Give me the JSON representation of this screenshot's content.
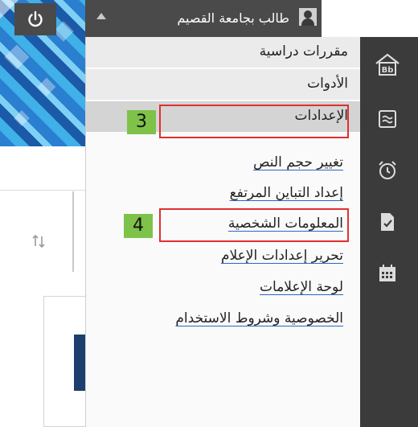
{
  "topbar": {
    "user_name": "طالب بجامعة القصيم",
    "power_icon": "power-icon",
    "caret_icon": "caret-up-icon"
  },
  "menu": {
    "items": [
      {
        "label": "مقررات دراسية"
      },
      {
        "label": "الأدوات"
      },
      {
        "label": "الإعدادات"
      }
    ],
    "links": [
      {
        "label": "تغيير حجم النص"
      },
      {
        "label": "إعداد التباين المرتفع"
      },
      {
        "label": "المعلومات الشخصية"
      },
      {
        "label": "تحرير إعدادات الإعلام"
      },
      {
        "label": "لوحة الإعلامات"
      },
      {
        "label": "الخصوصية وشروط الاستخدام"
      }
    ]
  },
  "callouts": [
    {
      "number": "3"
    },
    {
      "number": "4"
    }
  ],
  "sidebar_icons": [
    "bb-home-icon",
    "activity-stream-icon",
    "alarm-clock-icon",
    "grades-icon",
    "calendar-icon"
  ],
  "colors": {
    "dark": "#3b3b3b",
    "highlight": "#e03030",
    "callout": "#7ec24a",
    "link_underline": "#2a66c9"
  }
}
